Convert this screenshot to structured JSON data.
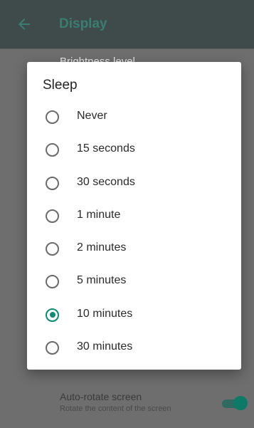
{
  "app_bar": {
    "title": "Display",
    "back_icon": "arrow-back-icon"
  },
  "background": {
    "brightness_title": "Brightness level",
    "auto_rotate": {
      "title": "Auto-rotate screen",
      "subtitle": "Rotate the content of the screen",
      "enabled": true
    }
  },
  "dialog": {
    "title": "Sleep",
    "selected_index": 6,
    "options": [
      {
        "label": "Never",
        "selected": false
      },
      {
        "label": "15 seconds",
        "selected": false
      },
      {
        "label": "30 seconds",
        "selected": false
      },
      {
        "label": "1 minute",
        "selected": false
      },
      {
        "label": "2 minutes",
        "selected": false
      },
      {
        "label": "5 minutes",
        "selected": false
      },
      {
        "label": "10 minutes",
        "selected": true
      },
      {
        "label": "30 minutes",
        "selected": false
      }
    ]
  },
  "colors": {
    "accent": "#0f8a74",
    "app_bar_title": "#3a7d72",
    "scrim": "#6e6e6e"
  }
}
